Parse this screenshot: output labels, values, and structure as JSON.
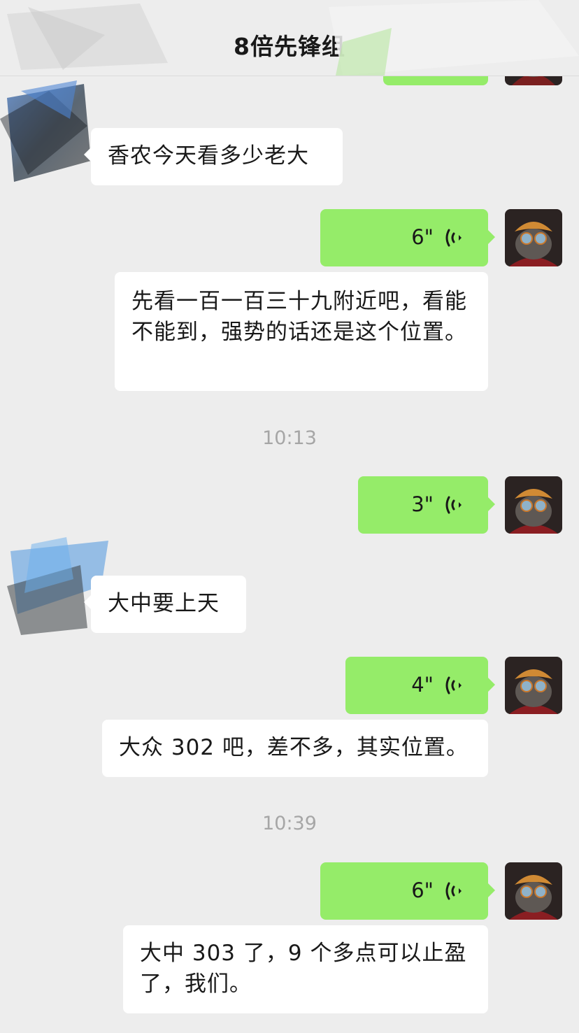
{
  "header": {
    "title": "8倍先锋组"
  },
  "colors": {
    "background": "#ededed",
    "sent_bubble": "#95ec69",
    "received_bubble": "#ffffff",
    "timestamp_text": "#a6a6a6"
  },
  "messages": [
    {
      "type": "text",
      "direction": "received",
      "text": "香农今天看多少老大"
    },
    {
      "type": "voice",
      "direction": "sent",
      "duration": "6\"",
      "icon": "voice-wave-icon"
    },
    {
      "type": "text",
      "direction": "received",
      "text": "先看一百一百三十九附近吧，看能不能到，强势的话还是这个位置。"
    },
    {
      "type": "timestamp",
      "text": "10:13"
    },
    {
      "type": "voice",
      "direction": "sent",
      "duration": "3\"",
      "icon": "voice-wave-icon"
    },
    {
      "type": "text",
      "direction": "received",
      "text": "大中要上天"
    },
    {
      "type": "voice",
      "direction": "sent",
      "duration": "4\"",
      "icon": "voice-wave-icon"
    },
    {
      "type": "text",
      "direction": "received",
      "text": "大众 302 吧，差不多，其实位置。"
    },
    {
      "type": "timestamp",
      "text": "10:39"
    },
    {
      "type": "voice",
      "direction": "sent",
      "duration": "6\"",
      "icon": "voice-wave-icon"
    },
    {
      "type": "text",
      "direction": "received",
      "text": "大中 303 了，9 个多点可以止盈了，我们。"
    }
  ]
}
